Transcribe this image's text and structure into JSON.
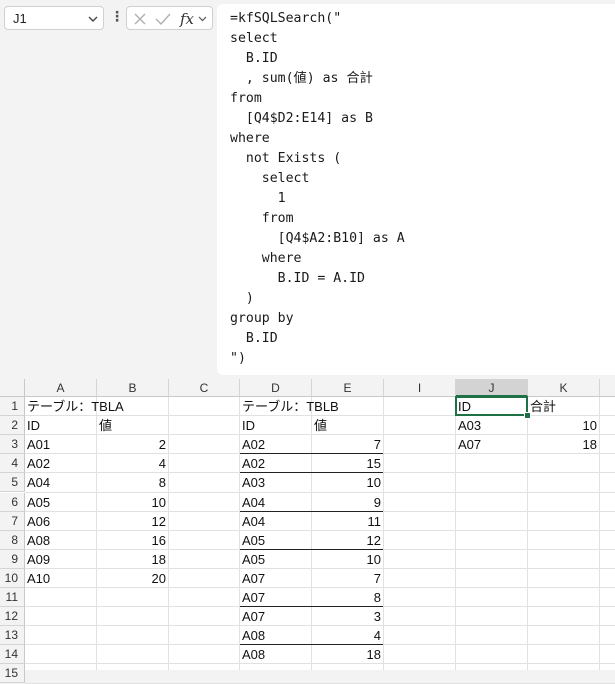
{
  "name_box": "J1",
  "formula_text": "=kfSQLSearch(\"\nselect\n  B.ID\n  , sum(値) as 合計\nfrom\n  [Q4$D2:E14] as B\nwhere\n  not Exists (\n    select\n      1\n    from\n      [Q4$A2:B10] as A\n    where\n      B.ID = A.ID\n  )\ngroup by\n  B.ID\n\")",
  "columns": [
    "A",
    "B",
    "C",
    "D",
    "E",
    "I",
    "J",
    "K"
  ],
  "rows": [
    "1",
    "2",
    "3",
    "4",
    "5",
    "6",
    "7",
    "8",
    "9",
    "10",
    "11",
    "12",
    "13",
    "14",
    "15"
  ],
  "table_a": {
    "title": "テーブル：TBLA",
    "header": [
      "ID",
      "値"
    ],
    "rows": [
      [
        "A01",
        "2"
      ],
      [
        "A02",
        "4"
      ],
      [
        "A04",
        "8"
      ],
      [
        "A05",
        "10"
      ],
      [
        "A06",
        "12"
      ],
      [
        "A08",
        "16"
      ],
      [
        "A09",
        "18"
      ],
      [
        "A10",
        "20"
      ]
    ]
  },
  "table_b": {
    "title": "テーブル：TBLB",
    "header": [
      "ID",
      "値"
    ],
    "rows": [
      [
        "A02",
        "7"
      ],
      [
        "A02",
        "15"
      ],
      [
        "A03",
        "10"
      ],
      [
        "A04",
        "9"
      ],
      [
        "A04",
        "11"
      ],
      [
        "A05",
        "12"
      ],
      [
        "A05",
        "10"
      ],
      [
        "A07",
        "7"
      ],
      [
        "A07",
        "8"
      ],
      [
        "A07",
        "3"
      ],
      [
        "A08",
        "4"
      ],
      [
        "A08",
        "18"
      ]
    ],
    "group_end_rows": [
      1,
      2,
      4,
      6,
      9,
      11
    ]
  },
  "result": {
    "header": [
      "ID",
      "合計"
    ],
    "rows": [
      [
        "A03",
        "10"
      ],
      [
        "A07",
        "18"
      ]
    ]
  },
  "colors": {
    "selection": "#1e7145",
    "header_bg": "#f3f3f3"
  }
}
